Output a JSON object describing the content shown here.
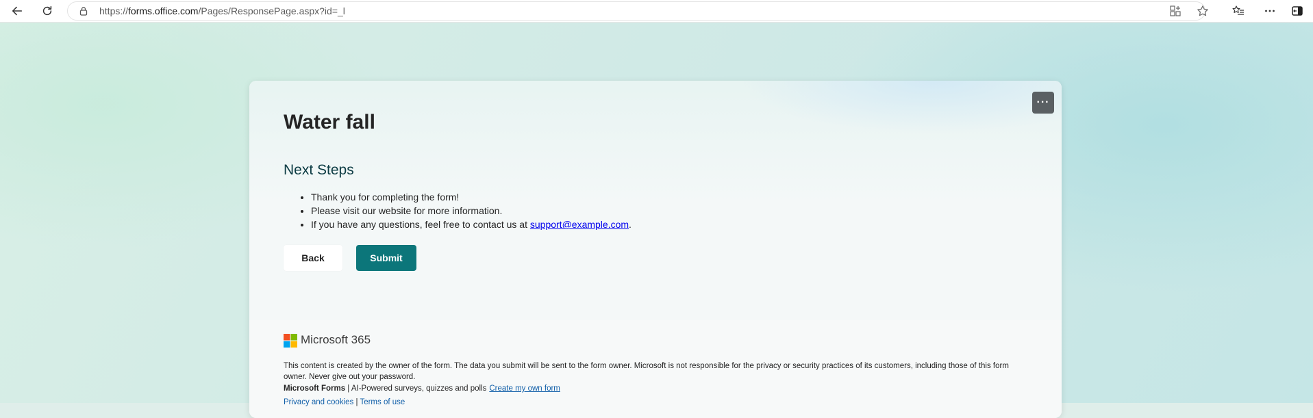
{
  "browser": {
    "url_prefix": "https://",
    "url_host": "forms.office.com",
    "url_path": "/Pages/ResponsePage.aspx?id=_l"
  },
  "form": {
    "title": "Water fall",
    "more_label": "···",
    "section_title": "Next Steps",
    "steps": [
      "Thank you for completing the form!",
      "Please visit our website for more information."
    ],
    "contact_text": "If you have any questions, feel free to contact us at ",
    "contact_email": "support@example.com",
    "contact_suffix": ".",
    "back_label": "Back",
    "submit_label": "Submit"
  },
  "footer": {
    "brand": "Microsoft 365",
    "disclaimer": "This content is created by the owner of the form. The data you submit will be sent to the form owner. Microsoft is not responsible for the privacy or security practices of its customers, including those of this form owner. Never give out your password.",
    "forms_brand": "Microsoft Forms",
    "forms_tagline": " | AI-Powered surveys, quizzes and polls",
    "create_link": "Create my own form",
    "privacy_link": "Privacy and cookies",
    "separator": " | ",
    "terms_link": "Terms of use"
  },
  "colors": {
    "accent": "#0c767a",
    "link": "#0f5ea8",
    "logo_red": "#f25022",
    "logo_green": "#7fba00",
    "logo_blue": "#00a4ef",
    "logo_yellow": "#ffb900"
  },
  "icons": {
    "back": "arrow-left-icon",
    "refresh": "refresh-icon",
    "lock": "lock-icon",
    "apps": "app-available-icon",
    "favorite": "star-icon",
    "favorites": "favorites-list-icon",
    "menu": "more-horizontal-icon",
    "sidebar": "sidebar-icon"
  }
}
